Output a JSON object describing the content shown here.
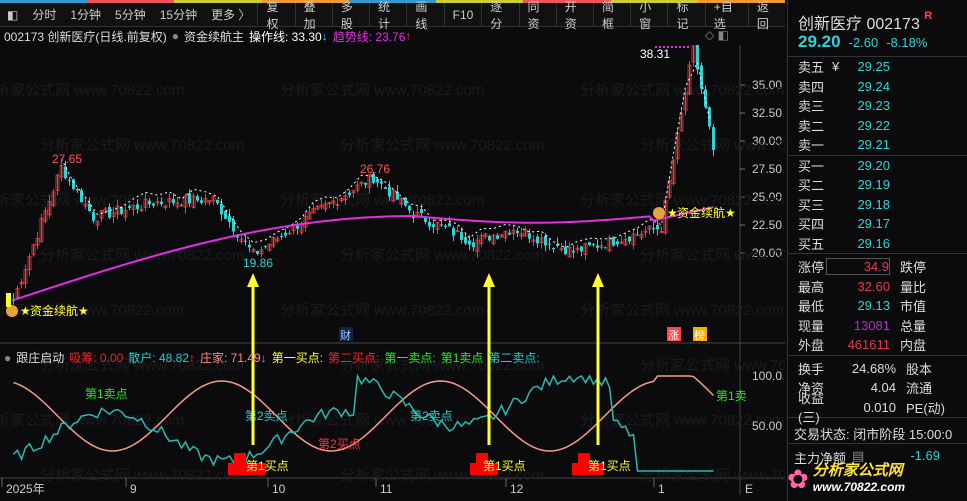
{
  "toolbar": {
    "left": [
      "分时",
      "1分钟",
      "5分钟",
      "15分钟",
      "更多 〉"
    ],
    "buttons": [
      "复权",
      "叠加",
      "多股",
      "统计",
      "画线",
      "F10",
      "逐分",
      "同资",
      "开资",
      "简框",
      "小窗",
      "标记",
      "+自选",
      "返回"
    ]
  },
  "info": {
    "code_name": "002173 创新医疗(日线.前复权)",
    "indicator": "资金续航主",
    "op_label": "操作线: 33.30",
    "op_arrow": "↓",
    "trend_label": "趋势线: 23.76",
    "trend_arrow": "↑"
  },
  "quote": {
    "title": "创新医疗 002173",
    "badge": "R",
    "price": "29.20",
    "change": "-2.60",
    "pct": "-8.18%",
    "asks": [
      {
        "l": "卖五",
        "m": "¥",
        "v": "29.25"
      },
      {
        "l": "卖四",
        "m": "",
        "v": "29.24"
      },
      {
        "l": "卖三",
        "m": "",
        "v": "29.23"
      },
      {
        "l": "卖二",
        "m": "",
        "v": "29.22"
      },
      {
        "l": "卖一",
        "m": "",
        "v": "29.21"
      }
    ],
    "bids": [
      {
        "l": "买一",
        "v": "29.20"
      },
      {
        "l": "买二",
        "v": "29.19"
      },
      {
        "l": "买三",
        "v": "29.18"
      },
      {
        "l": "买四",
        "v": "29.17"
      },
      {
        "l": "买五",
        "v": "29.16"
      }
    ],
    "stats": [
      {
        "l": "涨停",
        "v": "34.9",
        "r": "跌停",
        "c": "#e23b4c"
      },
      {
        "l": "最高",
        "v": "32.60",
        "r": "量比",
        "c": "#e23b4c"
      },
      {
        "l": "最低",
        "v": "29.13",
        "r": "市值",
        "c": "#2ed3d3"
      },
      {
        "l": "现量",
        "v": "13081",
        "r": "总量",
        "c": "#b030c8"
      },
      {
        "l": "外盘",
        "v": "461611",
        "r": "内盘",
        "c": "#e23b4c"
      }
    ],
    "stats2": [
      {
        "l": "换手",
        "v": "24.68%",
        "r": "股本"
      },
      {
        "l": "净资",
        "v": "4.04",
        "r": "流通"
      },
      {
        "l": "收益(三)",
        "v": "0.010",
        "r": "PE(动)"
      }
    ],
    "status": "交易状态: 闭市阶段 15:00:0",
    "net_label": "主力净额",
    "net_value": "-1.69"
  },
  "chart_data": {
    "type": "candlestick",
    "price_axis": [
      "35.00",
      "32.50",
      "30.00",
      "27.50",
      "25.00",
      "22.50",
      "20.00"
    ],
    "key_points": [
      [
        0,
        15.8
      ],
      [
        12,
        27.65
      ],
      [
        20,
        23.2
      ],
      [
        35,
        24.5
      ],
      [
        50,
        24.8
      ],
      [
        60,
        19.86
      ],
      [
        75,
        23.5
      ],
      [
        90,
        26.76
      ],
      [
        100,
        23.5
      ],
      [
        115,
        21.0
      ],
      [
        125,
        22.2
      ],
      [
        140,
        20.1
      ],
      [
        155,
        21.6
      ],
      [
        162,
        22.3
      ],
      [
        170,
        38.31
      ],
      [
        175,
        29.2
      ]
    ],
    "annotations": {
      "high1": "27.65",
      "low1": "19.86",
      "high2": "26.76",
      "high3": "38.31",
      "signal": "资金续航",
      "signal2": "资金续航"
    },
    "x_labels": [
      "2025年",
      "9",
      "10",
      "11",
      "12",
      "1"
    ],
    "markers": [
      "财",
      "涨",
      "榜"
    ]
  },
  "indicator": {
    "name": "跟庄启动",
    "xichou": "吸筹: 0.00",
    "sanhu": "散户: 48.82",
    "sanhu_arrow": "↑",
    "zhuangjia": "庄家: 71.49",
    "zj_arrow": "↓",
    "b1": "第一买点:",
    "b2": "第二买点:",
    "s1": "第一卖点:",
    "s1b": "第1卖点",
    "s2": "第二卖点:",
    "axis": [
      "100.0",
      "50.00"
    ],
    "labels": {
      "sell1": "第1卖点",
      "sell2a": "第2卖点",
      "sell2b": "第2卖点",
      "buy2": "第2买点",
      "buy1a": "第1买点",
      "buy1b": "第1买点",
      "buy1c": "第1买点",
      "sell1r": "第1卖"
    }
  },
  "watermark": "分析家公式网 www.70822.com",
  "logo": {
    "text": "分析家公式网",
    "url": "www.70822.com"
  }
}
